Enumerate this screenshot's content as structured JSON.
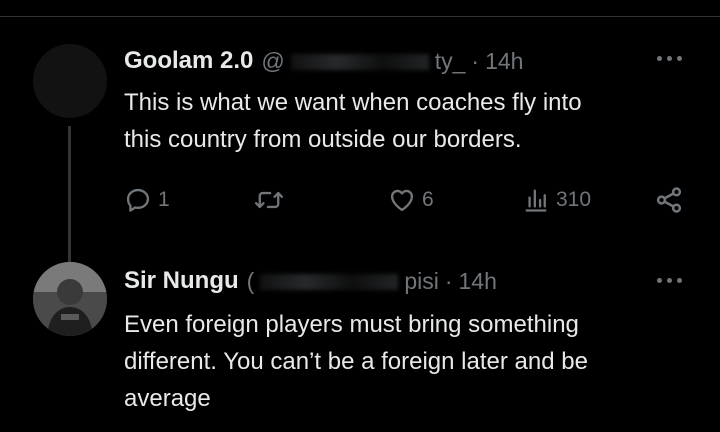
{
  "tweets": [
    {
      "display_name": "Goolam 2.0",
      "handle_prefix": "@",
      "handle_suffix": "ty_",
      "separator": "·",
      "time": "14h",
      "text": "This is what we want when coaches fly into\nthis country from outside our borders.",
      "actions": {
        "reply_count": "1",
        "retweet_count": "",
        "like_count": "6",
        "view_count": "310"
      }
    },
    {
      "display_name": "Sir Nungu",
      "handle_prefix": "(",
      "handle_suffix": "pisi",
      "separator": "·",
      "time": "14h",
      "text": "Even foreign players must bring something\ndifferent. You can’t be a foreign later and be\naverage"
    }
  ],
  "colors": {
    "background": "#000000",
    "primary_text": "#e7e9ea",
    "secondary_text": "#71767b",
    "divider": "#2f3336",
    "thread_line": "#333639"
  }
}
